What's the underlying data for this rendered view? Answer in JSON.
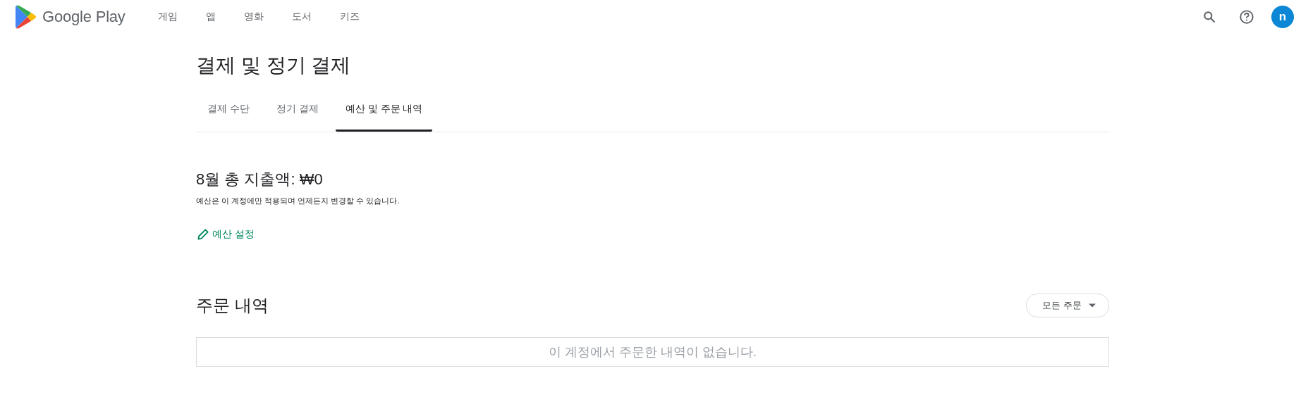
{
  "header": {
    "brand": "Google Play",
    "nav": [
      {
        "label": "게임"
      },
      {
        "label": "앱"
      },
      {
        "label": "영화"
      },
      {
        "label": "도서"
      },
      {
        "label": "키즈"
      }
    ],
    "avatar": "n"
  },
  "page": {
    "title": "결제 및 정기 결제",
    "tabs": [
      {
        "label": "결제 수단",
        "selected": false
      },
      {
        "label": "정기 결제",
        "selected": false
      },
      {
        "label": "예산 및 주문 내역",
        "selected": true
      }
    ]
  },
  "budget": {
    "heading": "8월 총 지출액: ₩0",
    "note": "예산은 이 계정에만 적용되며 언제든지 변경할 수 있습니다.",
    "link": "예산 설정"
  },
  "orders": {
    "heading": "주문 내역",
    "filter": "모든 주문",
    "empty": "이 계정에서 주문한 내역이 없습니다."
  }
}
